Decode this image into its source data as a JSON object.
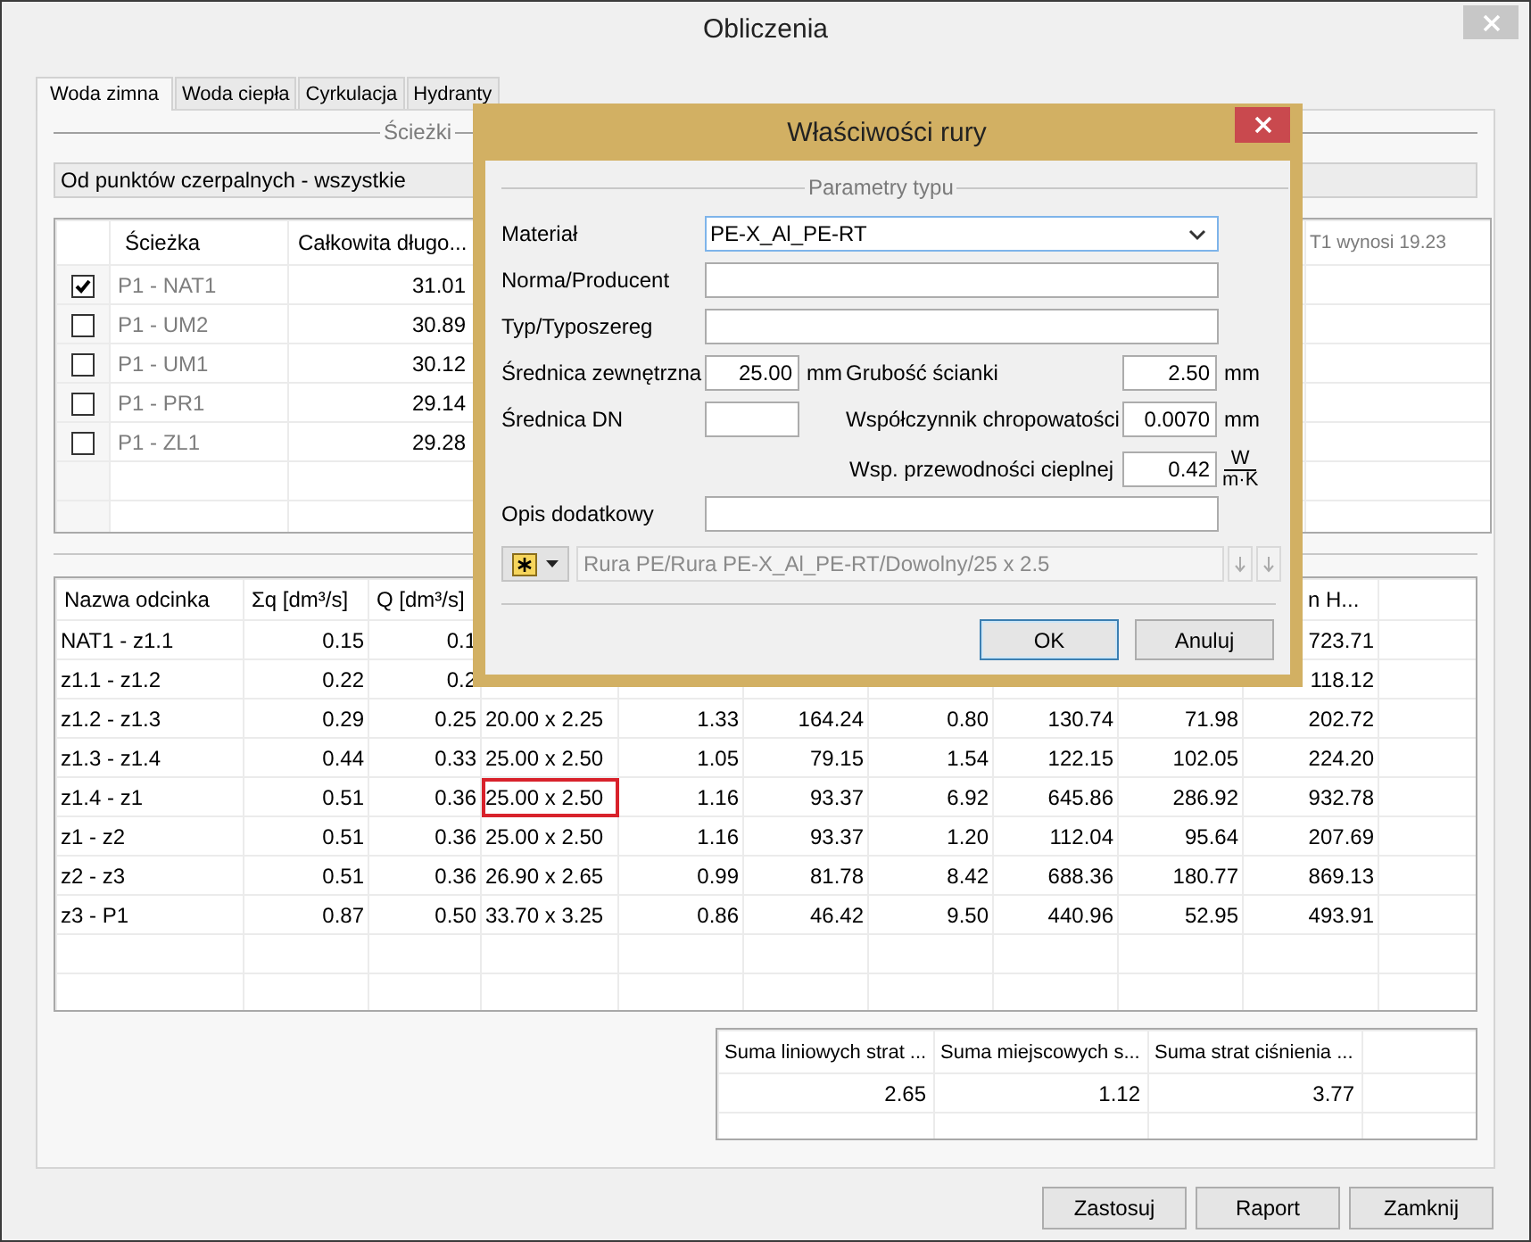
{
  "window": {
    "title": "Obliczenia"
  },
  "tabs": [
    {
      "label": "Woda zimna",
      "selected": true
    },
    {
      "label": "Woda ciepła",
      "selected": false
    },
    {
      "label": "Cyrkulacja",
      "selected": false
    },
    {
      "label": "Hydranty",
      "selected": false
    }
  ],
  "paths": {
    "group_title": "Ścieżki",
    "filter": "Od punktów czerpalnych - wszystkie",
    "columns": [
      "Ścieżka",
      "Całkowita długo..."
    ],
    "note": "T1 wynosi 19.23",
    "rows": [
      {
        "checked": true,
        "name": "P1 - NAT1",
        "length": "31.01"
      },
      {
        "checked": false,
        "name": "P1 - UM2",
        "length": "30.89"
      },
      {
        "checked": false,
        "name": "P1 - UM1",
        "length": "30.12"
      },
      {
        "checked": false,
        "name": "P1 - PR1",
        "length": "29.14"
      },
      {
        "checked": false,
        "name": "P1 - ZL1",
        "length": "29.28"
      }
    ]
  },
  "segments": {
    "columns": [
      "Nazwa odcinka",
      "Σq [dm³/s]",
      "Q [dm³/s]",
      null,
      null,
      null,
      null,
      null,
      null,
      "n H...",
      null
    ],
    "rows": [
      {
        "selected": false,
        "cells": [
          "NAT1 - z1.1",
          "0.15",
          "0.1",
          null,
          null,
          null,
          null,
          null,
          null,
          "723.71"
        ]
      },
      {
        "selected": false,
        "cells": [
          "z1.1 - z1.2",
          "0.22",
          "0.2",
          null,
          null,
          null,
          null,
          null,
          null,
          "118.12"
        ]
      },
      {
        "selected": false,
        "cells": [
          "z1.2 - z1.3",
          "0.29",
          "0.25",
          "20.00 x 2.25",
          "1.33",
          "164.24",
          "0.80",
          "130.74",
          "71.98",
          "202.72"
        ]
      },
      {
        "selected": false,
        "cells": [
          "z1.3 - z1.4",
          "0.44",
          "0.33",
          "25.00 x 2.50",
          "1.05",
          "79.15",
          "1.54",
          "122.15",
          "102.05",
          "224.20"
        ]
      },
      {
        "selected": true,
        "cells": [
          "z1.4 - z1",
          "0.51",
          "0.36",
          "25.00 x 2.50",
          "1.16",
          "93.37",
          "6.92",
          "645.86",
          "286.92",
          "932.78"
        ]
      },
      {
        "selected": false,
        "cells": [
          "z1 - z2",
          "0.51",
          "0.36",
          "25.00 x 2.50",
          "1.16",
          "93.37",
          "1.20",
          "112.04",
          "95.64",
          "207.69"
        ]
      },
      {
        "selected": false,
        "cells": [
          "z2 - z3",
          "0.51",
          "0.36",
          "26.90 x 2.65",
          "0.99",
          "81.78",
          "8.42",
          "688.36",
          "180.77",
          "869.13"
        ]
      },
      {
        "selected": false,
        "cells": [
          "z3 - P1",
          "0.87",
          "0.50",
          "33.70 x 3.25",
          "0.86",
          "46.42",
          "9.50",
          "440.96",
          "52.95",
          "493.91"
        ]
      }
    ]
  },
  "totals": {
    "columns": [
      "Suma liniowych strat ...",
      "Suma miejscowych s...",
      "Suma strat ciśnienia ..."
    ],
    "values": [
      "2.65",
      "1.12",
      "3.77"
    ]
  },
  "buttons": [
    "Zastosuj",
    "Raport",
    "Zamknij"
  ],
  "dialog": {
    "title": "Właściwości rury",
    "group_title": "Parametry typu",
    "material": {
      "label": "Materiał",
      "value": "PE-X_Al_PE-RT"
    },
    "standard": {
      "label": "Norma/Producent"
    },
    "type": {
      "label": "Typ/Typoszereg"
    },
    "outer_diameter": {
      "label": "Średnica zewnętrzna",
      "value": "25.00",
      "unit": "mm"
    },
    "dn": {
      "label": "Średnica DN"
    },
    "wall": {
      "label": "Grubość ścianki",
      "value": "2.50",
      "unit": "mm"
    },
    "roughness": {
      "label": "Współczynnik chropowatości",
      "value": "0.0070",
      "unit": "mm"
    },
    "conductivity": {
      "label": "Wsp. przewodności cieplnej",
      "value": "0.42",
      "unit_numerator": "W",
      "unit_denominator": "m·K"
    },
    "description": {
      "label": "Opis dodatkowy"
    },
    "catalog_path": "Rura PE/Rura PE-X_Al_PE-RT/Dowolny/25 x 2.5",
    "buttons": [
      {
        "label": "OK",
        "default": true
      },
      {
        "label": "Anuluj",
        "default": false
      }
    ]
  }
}
